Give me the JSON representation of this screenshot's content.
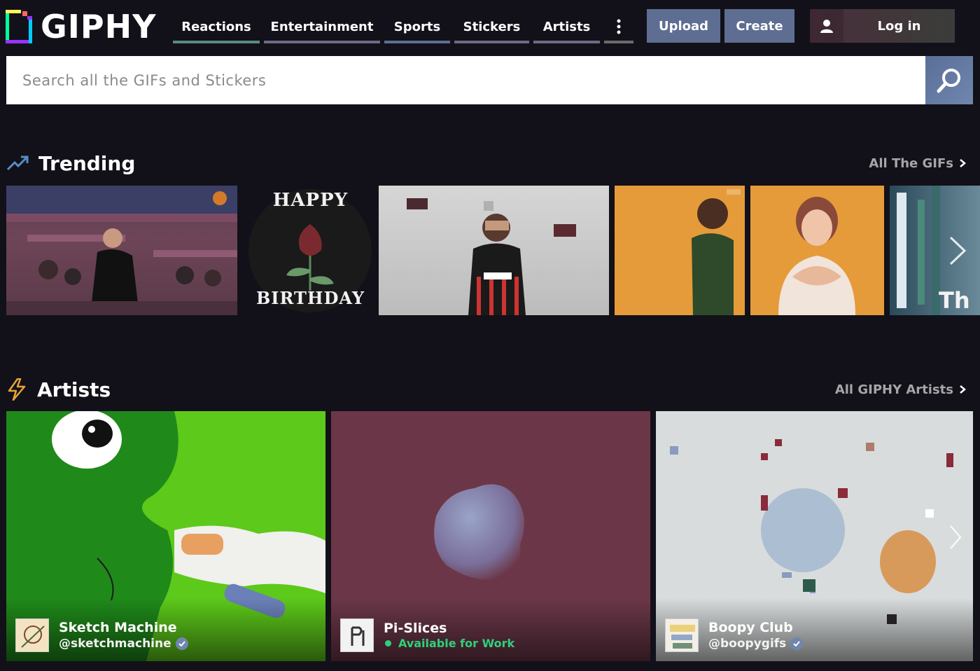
{
  "brand": {
    "name": "GIPHY"
  },
  "nav": {
    "items": [
      {
        "label": "Reactions",
        "underline": "#5a8a7e"
      },
      {
        "label": "Entertainment",
        "underline": "#6d6a86"
      },
      {
        "label": "Sports",
        "underline": "#5a6f98"
      },
      {
        "label": "Stickers",
        "underline": "#6d6a86"
      },
      {
        "label": "Artists",
        "underline": "#6d6a86"
      }
    ],
    "more_icon": "vertical-ellipsis-icon"
  },
  "actions": {
    "upload_label": "Upload",
    "create_label": "Create",
    "login_label": "Log in",
    "login_icon": "user-icon"
  },
  "search": {
    "placeholder": "Search all the GIFs and Stickers",
    "icon": "search-icon"
  },
  "trending": {
    "title": "Trending",
    "icon": "trending-up-icon",
    "link_label": "All The GIFs",
    "gifs": [
      {
        "alt": "coach celebrating in stadium"
      },
      {
        "alt": "Happy Birthday rose sticker",
        "caption_top": "HAPPY",
        "caption_bottom": "BIRTHDAY"
      },
      {
        "alt": "soccer player covering face"
      },
      {
        "alt": "man in green shirt on orange background"
      },
      {
        "alt": "woman making heart on orange background"
      },
      {
        "alt": "partial gif",
        "caption": "Th"
      }
    ]
  },
  "artists": {
    "title": "Artists",
    "icon": "lightning-icon",
    "link_label": "All GIPHY Artists",
    "cards": [
      {
        "name": "Sketch Machine",
        "handle": "@sketchmachine",
        "verified": true
      },
      {
        "name": "Pi-Slices",
        "status": "Available for Work"
      },
      {
        "name": "Boopy Club",
        "handle": "@boopygifs",
        "verified": true
      }
    ]
  },
  "colors": {
    "background": "#121119",
    "accent": "#5e6d92",
    "available_green": "#2fd07a"
  }
}
